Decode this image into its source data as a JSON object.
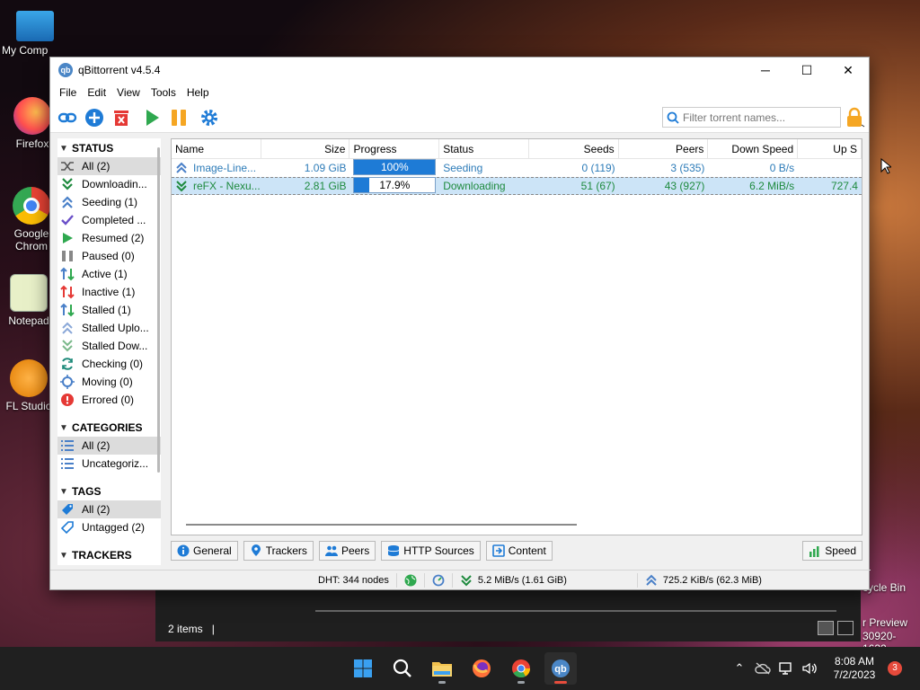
{
  "desktop": {
    "icons": [
      {
        "label": "My Comp"
      },
      {
        "label": "Firefox"
      },
      {
        "label": "Google Chrom"
      },
      {
        "label": "Notepad"
      },
      {
        "label": "FL Studio"
      }
    ],
    "recycle_label": "cycle Bin",
    "preview_line1": "r Preview",
    "preview_line2": "30920-1632"
  },
  "window": {
    "title": "qBittorrent v4.5.4",
    "app_icon_text": "qb",
    "controls": {
      "minimize": "─",
      "maximize": "☐",
      "close": "✕"
    }
  },
  "menu": [
    "File",
    "Edit",
    "View",
    "Tools",
    "Help"
  ],
  "search": {
    "placeholder": "Filter torrent names..."
  },
  "sidebar": {
    "status_header": "STATUS",
    "status_items": [
      {
        "label": "All (2)",
        "selected": true,
        "icon": "shuffle-icon"
      },
      {
        "label": "Downloadin...",
        "icon": "download-icon"
      },
      {
        "label": "Seeding (1)",
        "icon": "upload-icon"
      },
      {
        "label": "Completed ...",
        "icon": "check-icon"
      },
      {
        "label": "Resumed (2)",
        "icon": "play-icon"
      },
      {
        "label": "Paused (0)",
        "icon": "pause-icon"
      },
      {
        "label": "Active (1)",
        "icon": "active-icon"
      },
      {
        "label": "Inactive (1)",
        "icon": "inactive-icon"
      },
      {
        "label": "Stalled (1)",
        "icon": "stalled-icon"
      },
      {
        "label": "Stalled Uplo...",
        "icon": "stalled-upload-icon"
      },
      {
        "label": "Stalled Dow...",
        "icon": "stalled-download-icon"
      },
      {
        "label": "Checking (0)",
        "icon": "checking-icon"
      },
      {
        "label": "Moving (0)",
        "icon": "moving-icon"
      },
      {
        "label": "Errored (0)",
        "icon": "error-icon"
      }
    ],
    "categories_header": "CATEGORIES",
    "category_items": [
      {
        "label": "All (2)",
        "selected": true
      },
      {
        "label": "Uncategoriz..."
      }
    ],
    "tags_header": "TAGS",
    "tag_items": [
      {
        "label": "All (2)",
        "selected": true
      },
      {
        "label": "Untagged (2)"
      }
    ],
    "trackers_header": "TRACKERS"
  },
  "table": {
    "columns": [
      "Name",
      "Size",
      "Progress",
      "Status",
      "Seeds",
      "Peers",
      "Down Speed",
      "Up S"
    ],
    "rows": [
      {
        "name": "Image-Line...",
        "size": "1.09 GiB",
        "progress_text": "100%",
        "progress": 1.0,
        "status": "Seeding",
        "seeds": "0 (119)",
        "peers": "3 (535)",
        "down": "0 B/s",
        "up": ""
      },
      {
        "name": "reFX - Nexu...",
        "size": "2.81 GiB",
        "progress_text": "17.9%",
        "progress": 0.179,
        "status": "Downloading",
        "seeds": "51 (67)",
        "peers": "43 (927)",
        "down": "6.2 MiB/s",
        "up": "727.4"
      }
    ]
  },
  "tabs": [
    "General",
    "Trackers",
    "Peers",
    "HTTP Sources",
    "Content"
  ],
  "speed_tab": "Speed",
  "statusbar": {
    "dht": "DHT: 344 nodes",
    "down": "5.2 MiB/s (1.61 GiB)",
    "up": "725.2 KiB/s (62.3 MiB)"
  },
  "explorer": {
    "items": "2 items",
    "sep": "|"
  },
  "taskbar": {
    "time": "8:08 AM",
    "date": "7/2/2023",
    "notifications": "3"
  },
  "colors": {
    "accent": "#1e7bd6",
    "seeding": "#2c7bb8",
    "downloading": "#1e8a3e",
    "pause": "#f5a623",
    "delete": "#e53935"
  }
}
